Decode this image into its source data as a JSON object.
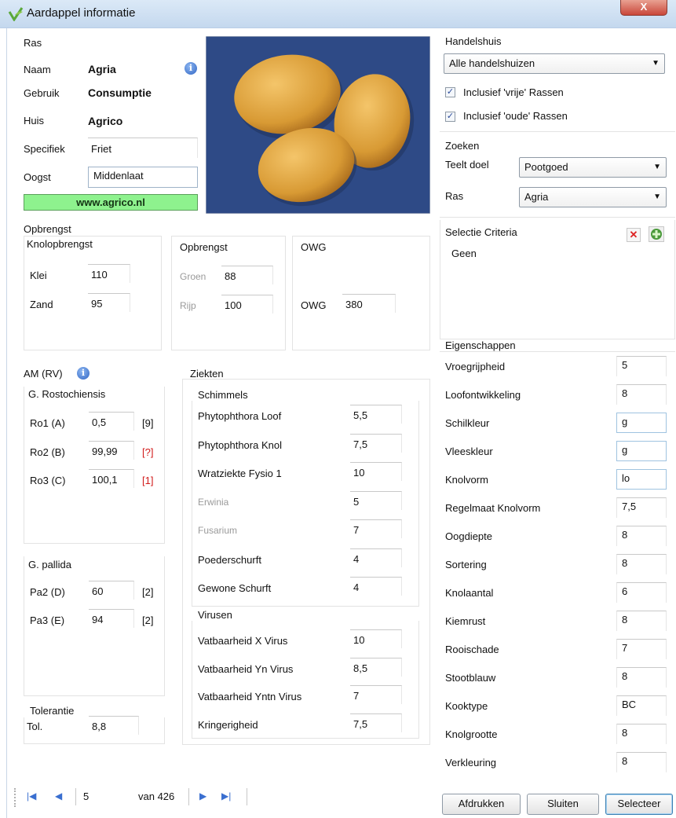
{
  "window": {
    "title": "Aardappel informatie",
    "close_label": "X"
  },
  "ras": {
    "section_label": "Ras",
    "naam_label": "Naam",
    "naam_value": "Agria",
    "gebruik_label": "Gebruik",
    "gebruik_value": "Consumptie",
    "huis_label": "Huis",
    "huis_value": "Agrico",
    "specifiek_label": "Specifiek",
    "specifiek_value": "Friet",
    "oogst_label": "Oogst",
    "oogst_value": "Middenlaat",
    "website": "www.agrico.nl"
  },
  "handelshuis": {
    "section_label": "Handelshuis",
    "selected": "Alle handelshuizen",
    "vrije_label": "Inclusief 'vrije' Rassen",
    "oude_label": "Inclusief 'oude' Rassen"
  },
  "zoeken": {
    "section_label": "Zoeken",
    "teelt_label": "Teelt doel",
    "teelt_value": "Pootgoed",
    "ras_label": "Ras",
    "ras_value": "Agria"
  },
  "selectie": {
    "section_label": "Selectie Criteria",
    "value": "Geen"
  },
  "opbrengst": {
    "section_label": "Opbrengst",
    "knol_label": "Knolopbrengst",
    "klei_label": "Klei",
    "klei_value": "110",
    "zand_label": "Zand",
    "zand_value": "95",
    "opb_label": "Opbrengst",
    "groen_label": "Groen",
    "groen_value": "88",
    "rijp_label": "Rijp",
    "rijp_value": "100",
    "owg_group_label": "OWG",
    "owg_label": "OWG",
    "owg_value": "380"
  },
  "am": {
    "section_label": "AM (RV)",
    "rosto_label": "G. Rostochiensis",
    "rows_rosto": [
      {
        "label": "Ro1 (A)",
        "value": "0,5",
        "code": "[9]",
        "red": false
      },
      {
        "label": "Ro2 (B)",
        "value": "99,99",
        "code": "[?]",
        "red": true
      },
      {
        "label": "Ro3 (C)",
        "value": "100,1",
        "code": "[1]",
        "red": true
      }
    ],
    "pallida_label": "G. pallida",
    "rows_pallida": [
      {
        "label": "Pa2 (D)",
        "value": "60",
        "code": "[2]"
      },
      {
        "label": "Pa3 (E)",
        "value": "94",
        "code": "[2]"
      }
    ],
    "tolerantie_label": "Tolerantie",
    "tol_label": "Tol.",
    "tol_value": "8,8"
  },
  "ziekten": {
    "section_label": "Ziekten",
    "schimmels_label": "Schimmels",
    "schimmels": [
      {
        "label": "Phytophthora Loof",
        "value": "5,5",
        "grey": false
      },
      {
        "label": "Phytophthora Knol",
        "value": "7,5",
        "grey": false
      },
      {
        "label": "Wratziekte Fysio 1",
        "value": "10",
        "grey": false
      },
      {
        "label": "Erwinia",
        "value": "5",
        "grey": true
      },
      {
        "label": "Fusarium",
        "value": "7",
        "grey": true
      },
      {
        "label": "Poederschurft",
        "value": "4",
        "grey": false
      },
      {
        "label": "Gewone Schurft",
        "value": "4",
        "grey": false
      }
    ],
    "virusen_label": "Virusen",
    "virusen": [
      {
        "label": "Vatbaarheid X Virus",
        "value": "10"
      },
      {
        "label": "Vatbaarheid Yn Virus",
        "value": "8,5"
      },
      {
        "label": "Vatbaarheid Yntn Virus",
        "value": "7"
      },
      {
        "label": "Kringerigheid",
        "value": "7,5"
      }
    ]
  },
  "eigenschappen": {
    "section_label": "Eigenschappen",
    "rows": [
      {
        "label": "Vroegrijpheid",
        "value": "5"
      },
      {
        "label": "Loofontwikkeling",
        "value": "8"
      },
      {
        "label": "Schilkleur",
        "value": "g"
      },
      {
        "label": "Vleeskleur",
        "value": "g"
      },
      {
        "label": "Knolvorm",
        "value": "lo"
      },
      {
        "label": "Regelmaat Knolvorm",
        "value": "7,5"
      },
      {
        "label": "Oogdiepte",
        "value": "8"
      },
      {
        "label": "Sortering",
        "value": "8"
      },
      {
        "label": "Knolaantal",
        "value": "6"
      },
      {
        "label": "Kiemrust",
        "value": "8"
      },
      {
        "label": "Rooischade",
        "value": "7"
      },
      {
        "label": "Stootblauw",
        "value": "8"
      },
      {
        "label": "Kooktype",
        "value": "BC"
      },
      {
        "label": "Knolgrootte",
        "value": "8"
      },
      {
        "label": "Verkleuring",
        "value": "8"
      }
    ]
  },
  "navigator": {
    "position": "5",
    "total_text": "van 426"
  },
  "buttons": {
    "print": "Afdrukken",
    "close": "Sluiten",
    "select": "Selecteer"
  },
  "colors": {
    "website_bg": "#8ef28e",
    "image_bg": "#2e4a86",
    "potato": "#dda23c"
  }
}
